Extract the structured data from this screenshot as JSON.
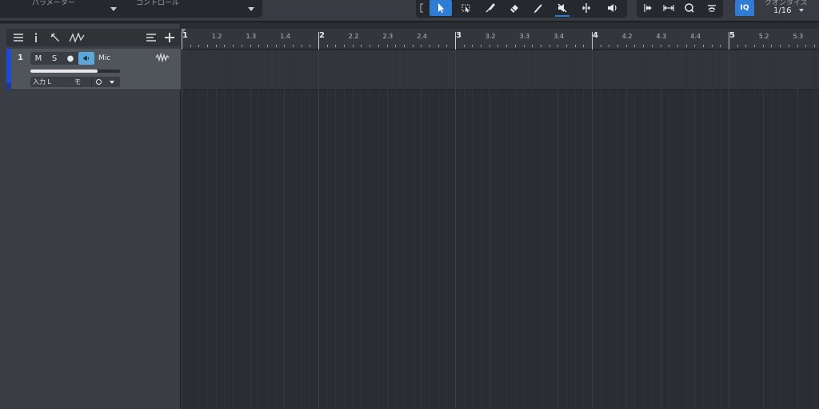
{
  "toolbar": {
    "parameter_label": "パラメーター",
    "control_label": "コントロール",
    "iq_label": "IQ",
    "quantize_label": "クオンタイズ",
    "quantize_value": "1/16",
    "tools": [
      {
        "name": "arrow-tool",
        "active": true
      },
      {
        "name": "range-tool",
        "active": false
      },
      {
        "name": "split-tool",
        "active": false
      },
      {
        "name": "eraser-tool",
        "active": false
      },
      {
        "name": "paint-tool",
        "active": false
      },
      {
        "name": "mute-tool",
        "active": false
      },
      {
        "name": "bend-tool",
        "active": false
      },
      {
        "name": "listen-tool",
        "active": false
      }
    ],
    "colors": {
      "accent": "#2f7cd6",
      "panel": "#25282c"
    }
  },
  "track_panel": {
    "tracks": [
      {
        "number": "1",
        "mute_label": "M",
        "solo_label": "S",
        "record_symbol": "●",
        "name": "Mic",
        "volume": 0.75,
        "input_label": "入力 L",
        "mono_label": "モ",
        "color": "#1f4bd4"
      }
    ]
  },
  "ruler": {
    "labels": [
      "1",
      "1.2",
      "1.3",
      "1.4",
      "2",
      "2.2",
      "2.3",
      "2.4",
      "3",
      "3.2",
      "3.3",
      "3.4",
      "4",
      "4.2",
      "4.3",
      "4.4",
      "5",
      "5.2",
      "5.3"
    ]
  }
}
